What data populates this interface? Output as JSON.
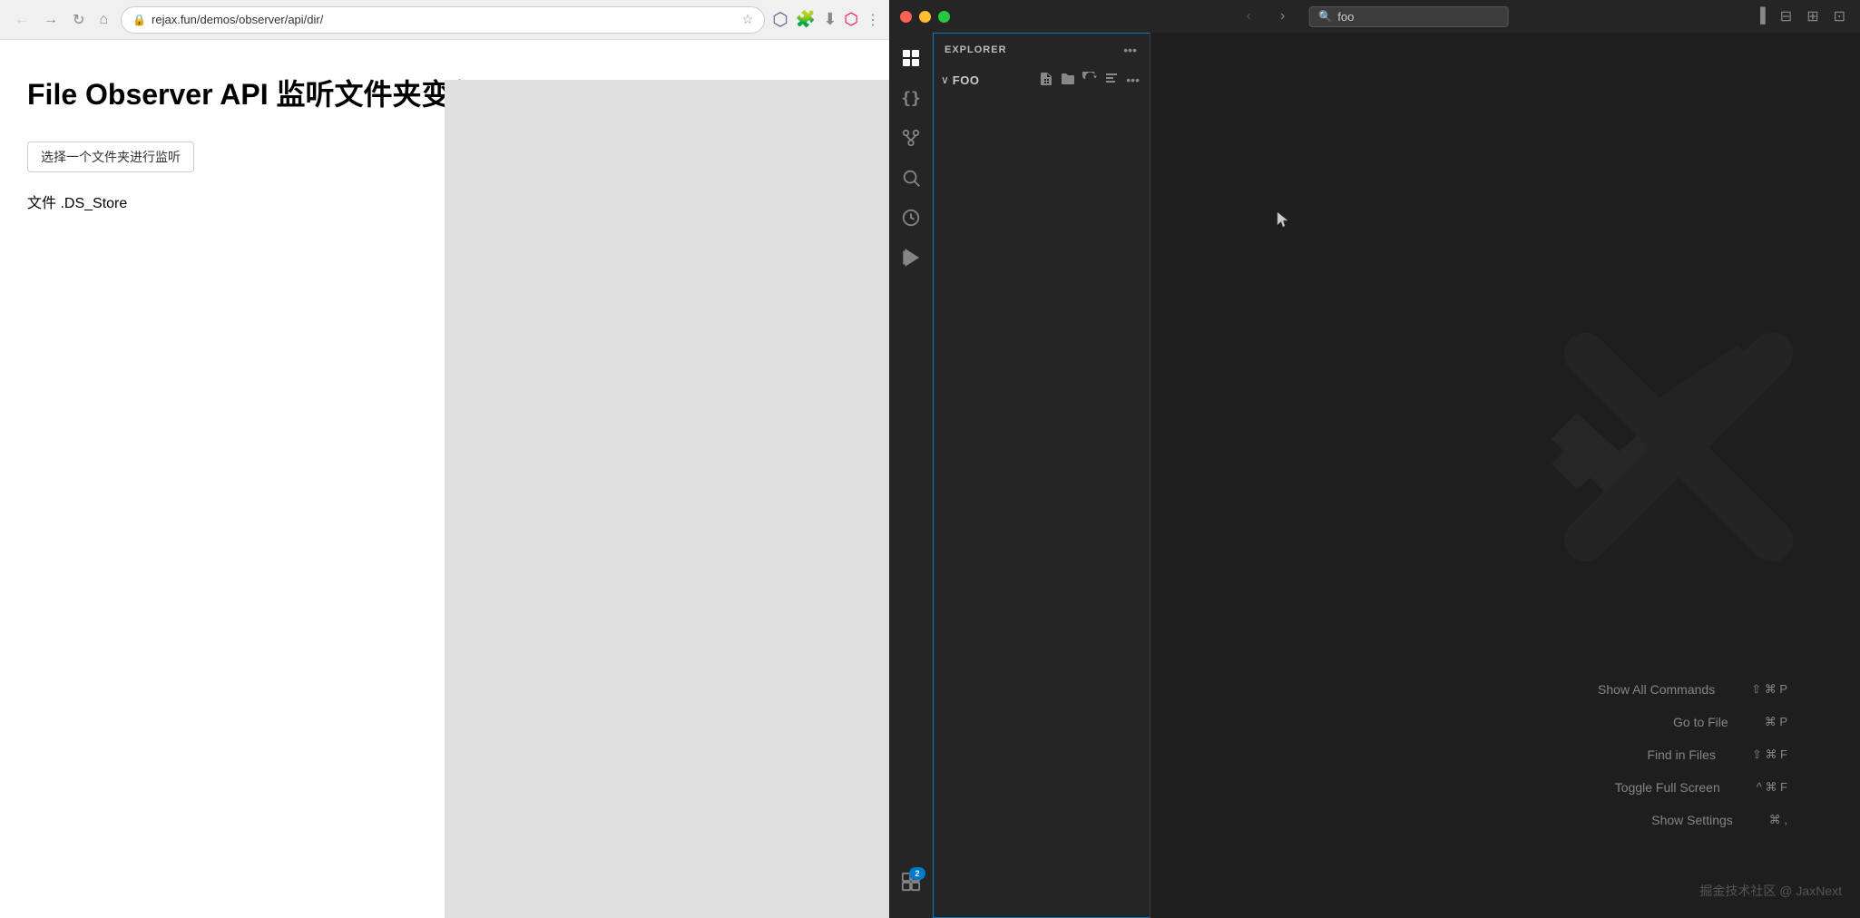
{
  "browser": {
    "url": "rejax.fun/demos/observer/api/dir/",
    "nav": {
      "back_label": "←",
      "forward_label": "→",
      "refresh_label": "↻",
      "home_label": "⌂"
    },
    "page": {
      "title": "File Observer API 监听文件夹变化",
      "select_folder_btn": "选择一个文件夹进行监听",
      "file_info": "文件 .DS_Store"
    }
  },
  "vscode": {
    "titlebar": {
      "back_label": "‹",
      "forward_label": "›",
      "search_placeholder": "foo"
    },
    "activity_bar": {
      "items": [
        {
          "name": "explorer",
          "icon": "⎘",
          "active": true
        },
        {
          "name": "outline",
          "icon": "{}"
        },
        {
          "name": "source-control",
          "icon": "⎇"
        },
        {
          "name": "search",
          "icon": "🔍"
        },
        {
          "name": "debug",
          "icon": "▶"
        },
        {
          "name": "extensions",
          "icon": "⊞",
          "badge": "2"
        }
      ]
    },
    "sidebar": {
      "title": "EXPLORER",
      "section": {
        "name": "FOO",
        "chevron": "∨"
      }
    },
    "shortcuts": [
      {
        "label": "Show All Commands",
        "keys": "⇧ ⌘ P"
      },
      {
        "label": "Go to File",
        "keys": "⌘ P"
      },
      {
        "label": "Find in Files",
        "keys": "⇧ ⌘ F"
      },
      {
        "label": "Toggle Full Screen",
        "keys": "^ ⌘ F"
      },
      {
        "label": "Show Settings",
        "keys": "⌘ ,"
      }
    ],
    "watermark": "掘金技术社区 @ JaxNext"
  }
}
